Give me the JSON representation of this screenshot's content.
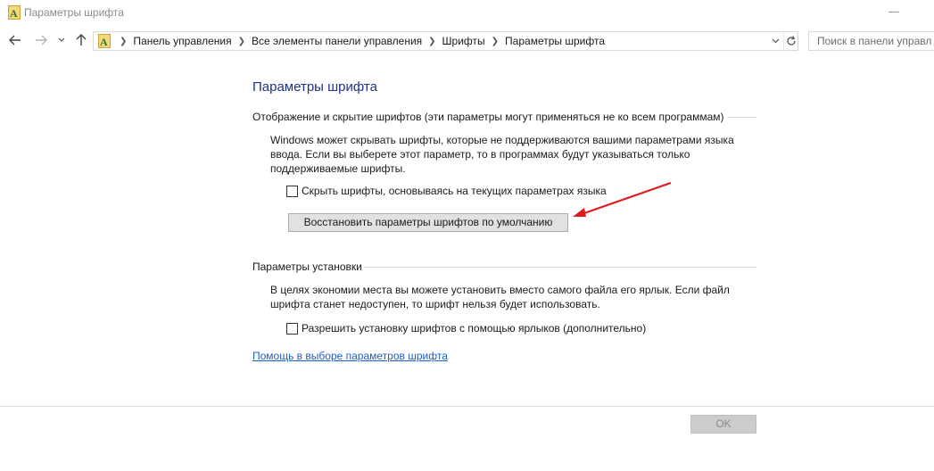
{
  "window": {
    "title": "Параметры шрифта",
    "icon": "font-folder-icon"
  },
  "nav": {
    "breadcrumbs": [
      "Панель управления",
      "Все элементы панели управления",
      "Шрифты",
      "Параметры шрифта"
    ],
    "search_placeholder": "Поиск в панели управл"
  },
  "main": {
    "title": "Параметры шрифта",
    "display_section": {
      "heading": "Отображение и скрытие шрифтов (эти параметры могут применяться не ко всем программам)",
      "description_lines": [
        "Windows может скрывать шрифты, которые не поддерживаются вашими параметрами языка",
        "ввода. Если вы выберете этот параметр, то в программах будут указываться только",
        "поддерживаемые шрифты."
      ],
      "hide_fonts_label": "Скрыть шрифты, основываясь на текущих параметрах языка",
      "hide_fonts_checked": false,
      "restore_button": "Восстановить параметры шрифтов по умолчанию"
    },
    "install_section": {
      "heading": "Параметры установки",
      "description_lines": [
        "В целях экономии места вы можете установить вместо самого файла его ярлык. Если файл",
        "шрифта станет недоступен, то шрифт нельзя будет использовать."
      ],
      "shortcut_label": "Разрешить установку шрифтов с помощью ярлыков (дополнительно)",
      "shortcut_checked": false
    },
    "help_link": "Помощь в выборе параметров шрифта"
  },
  "footer": {
    "ok_button": "OK"
  },
  "colors": {
    "title_blue": "#1e3287",
    "link_blue": "#1e5fc0",
    "arrow_red": "#e0191b"
  }
}
